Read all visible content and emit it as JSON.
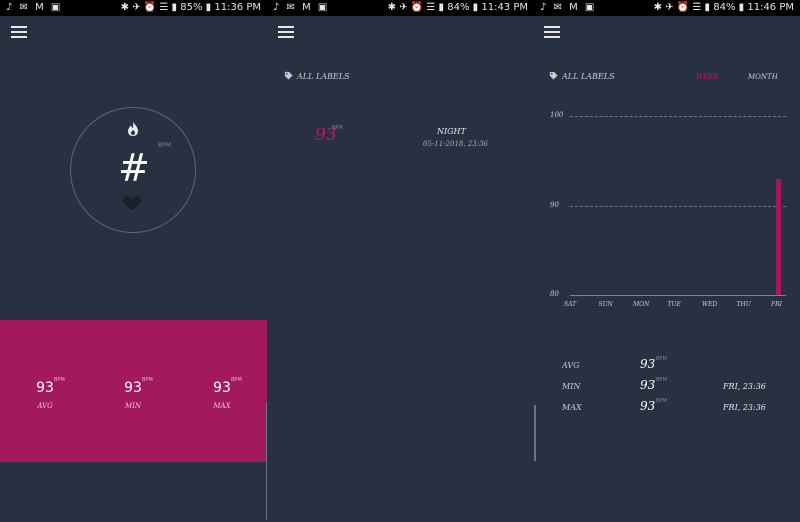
{
  "screens": [
    {
      "status": {
        "time": "11:36 PM",
        "battery": "85%"
      },
      "center": {
        "value": "#",
        "unit": "BPM"
      },
      "stats": [
        {
          "value": "93",
          "unit": "BPM",
          "label": "AVG"
        },
        {
          "value": "93",
          "unit": "BPM",
          "label": "MIN"
        },
        {
          "value": "93",
          "unit": "BPM",
          "label": "MAX"
        }
      ]
    },
    {
      "status": {
        "time": "11:43 PM",
        "battery": "84%"
      },
      "filter_label": "ALL LABELS",
      "record": {
        "value": "93",
        "unit": "BPM",
        "title": "NIGHT",
        "date": "05-11-2018, 23:36"
      }
    },
    {
      "status": {
        "time": "11:46 PM",
        "battery": "84%"
      },
      "filter_label": "ALL LABELS",
      "range_toggle": {
        "week": "WEEK",
        "month": "MONTH",
        "active": "week"
      },
      "summary": [
        {
          "label": "AVG",
          "value": "93",
          "unit": "BPM",
          "date": ""
        },
        {
          "label": "MIN",
          "value": "93",
          "unit": "BPM",
          "date": "FRI, 23:36"
        },
        {
          "label": "MAX",
          "value": "93",
          "unit": "BPM",
          "date": "FRI, 23:36"
        }
      ]
    }
  ],
  "chart_data": {
    "type": "bar",
    "categories": [
      "SAT",
      "SUN",
      "MON",
      "TUE",
      "WED",
      "THU",
      "FRI"
    ],
    "values": [
      null,
      null,
      null,
      null,
      null,
      null,
      93
    ],
    "yticks": [
      80,
      90,
      100
    ],
    "ylim": [
      80,
      100
    ],
    "grid": true
  },
  "colors": {
    "accent": "#a3195e",
    "accent_text": "#c9156a",
    "background": "#273142"
  }
}
